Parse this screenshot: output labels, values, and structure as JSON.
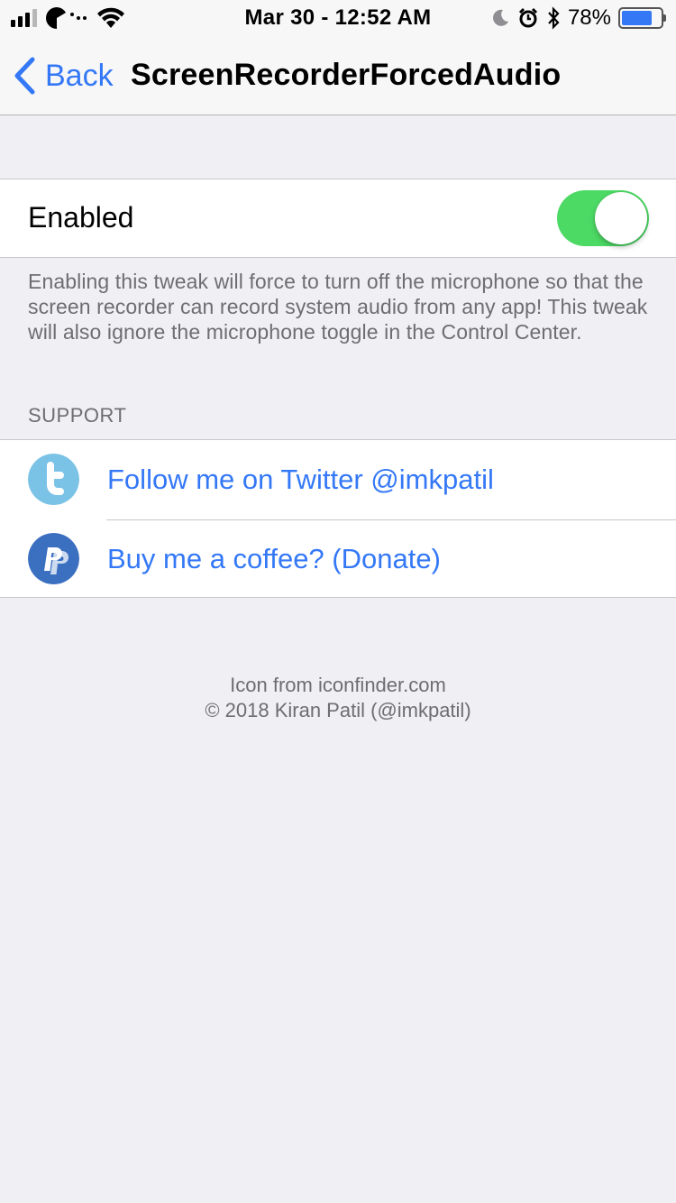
{
  "status_bar": {
    "time": "Mar 30 - 12:52 AM",
    "battery_percent": "78%",
    "battery_level": 0.78,
    "icons": [
      "signal-icon",
      "carrier-logo-icon",
      "wifi-icon",
      "moon-icon",
      "alarm-icon",
      "bluetooth-icon",
      "battery-icon"
    ]
  },
  "nav": {
    "back_label": "Back",
    "title": "ScreenRecorderForcedAudio"
  },
  "settings": {
    "enabled_label": "Enabled",
    "enabled_value": true,
    "enabled_footer": "Enabling this tweak will force to turn off the microphone so that the screen recorder can record system audio from any app! This tweak will also ignore the microphone toggle in the Control Center."
  },
  "support": {
    "header": "SUPPORT",
    "items": [
      {
        "label": "Follow me on Twitter @imkpatil",
        "icon": "twitter-icon"
      },
      {
        "label": "Buy me a coffee? (Donate)",
        "icon": "paypal-icon"
      }
    ]
  },
  "credits": {
    "line1": "Icon from iconfinder.com",
    "line2": "© 2018 Kiran Patil (@imkpatil)"
  },
  "colors": {
    "accent": "#3478f6",
    "toggle_on": "#4cd964",
    "twitter": "#7ac2e6",
    "paypal": "#3b6fc0",
    "background": "#efeff4"
  }
}
